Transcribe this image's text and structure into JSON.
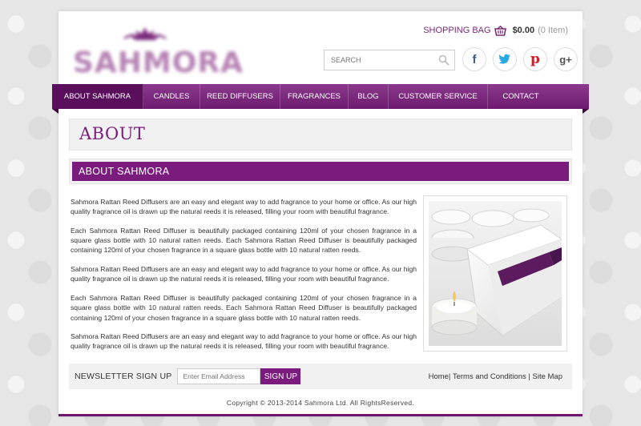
{
  "brand": {
    "name": "SAHMORA",
    "logo_color": "#b582b3",
    "accent": "#7b1b7e"
  },
  "cart": {
    "label": "SHOPPING BAG",
    "amount": "$0.00",
    "items": "(0 Item)",
    "icon": "basket-icon"
  },
  "search": {
    "placeholder": "SEARCH",
    "icon": "magnifier-icon"
  },
  "socials": [
    {
      "name": "facebook",
      "glyph": "f",
      "color": "#3b5998"
    },
    {
      "name": "twitter",
      "glyph": "t",
      "color": "#29a9e1"
    },
    {
      "name": "pinterest",
      "glyph": "p",
      "color": "#cb2027"
    },
    {
      "name": "google-plus",
      "glyph": "g+",
      "color": "#dd4b39"
    }
  ],
  "nav": {
    "items": [
      {
        "label": "ABOUT SAHMORA",
        "active": true
      },
      {
        "label": "CANDLES"
      },
      {
        "label": "REED DIFFUSERS"
      },
      {
        "label": "FRAGRANCES"
      },
      {
        "label": "BLOG"
      },
      {
        "label": "CUSTOMER SERVICE"
      },
      {
        "label": "CONTACT"
      }
    ]
  },
  "page": {
    "title": "ABOUT",
    "section_title": "ABOUT SAHMORA",
    "paragraphs": [
      "Sahmora Rattan Reed Diffusers are an easy and elegant way to add fragrance to your home or office. As our high quality fragrance oil is drawn up the natural reeds it is released, filling your room with beautiful fragrance.",
      "Each Sahmora Rattan Reed Diffuser is beautifully packaged containing 120ml of your chosen fragrance in a square glass bottle with 10 natural ratten reeds. Each Sahmora Rattan Reed Diffuser is beautifully packaged containing 120ml of your chosen fragrance in a square glass bottle with 10 natural ratten reeds.",
      "Sahmora Rattan Reed Diffusers are an easy and elegant way to add fragrance to your home or office. As our high quality fragrance oil is drawn up the natural reeds it is released, filling your room with beautiful fragrance.",
      "Each Sahmora Rattan Reed Diffuser is beautifully packaged containing 120ml of your chosen fragrance in a square glass bottle with 10 natural ratten reeds. Each Sahmora Rattan Reed Diffuser is beautifully packaged containing 120ml of your chosen fragrance in a square glass bottle with 10 natural ratten reeds.",
      "Sahmora Rattan Reed Diffusers are an easy and elegant way to add fragrance to your home or office. As our high quality fragrance oil is drawn up the natural reeds it is released, filling your room with beautiful fragrance."
    ]
  },
  "footer": {
    "newsletter_label": "NEWSLETTER SIGN UP",
    "email_placeholder": "Enter Email Address",
    "signup_label": "SIGN UP",
    "links": [
      "Home",
      "Terms and Conditions",
      "Site Map"
    ],
    "copyright": "Copyright © 2013-2014 Sahmora Ltd. All RightsReserved."
  }
}
